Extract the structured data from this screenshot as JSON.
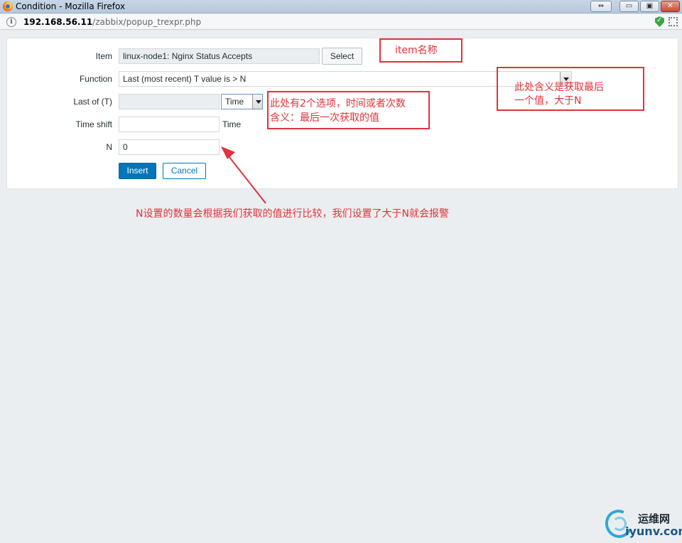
{
  "window": {
    "title": "Condition - Mozilla Firefox",
    "controls": {
      "restore": "⇔",
      "minimize": "▭",
      "maximize": "▣",
      "close": "✕"
    }
  },
  "address_bar": {
    "host": "192.168.56.11",
    "path": "/zabbix/popup_trexpr.php"
  },
  "form": {
    "item": {
      "label": "Item",
      "value": "linux-node1: Nginx Status Accepts",
      "select_button": "Select"
    },
    "function": {
      "label": "Function",
      "value": "Last (most recent) T value is > N"
    },
    "last_of": {
      "label": "Last of (T)",
      "value": "",
      "unit_selected": "Time"
    },
    "time_shift": {
      "label": "Time shift",
      "value": "",
      "unit": "Time"
    },
    "n": {
      "label": "N",
      "value": "0"
    },
    "insert_button": "Insert",
    "cancel_button": "Cancel"
  },
  "annotations": {
    "item_note": "item名称",
    "function_note_line1": "此处含义是获取最后",
    "function_note_line2": "一个值，大于N",
    "lastof_note_line1": "此处有2个选项，时间或者次数",
    "lastof_note_line2": "含义：最后一次获取的值",
    "n_note": "N设置的数量会根据我们获取的值进行比较，我们设置了大于N就会报警"
  },
  "watermark": {
    "cn": "运维网",
    "en": "iyunv.com"
  },
  "colors": {
    "annotation_red": "#e2323a",
    "zabbix_blue": "#0275b8",
    "page_bg": "#ebeef0"
  }
}
